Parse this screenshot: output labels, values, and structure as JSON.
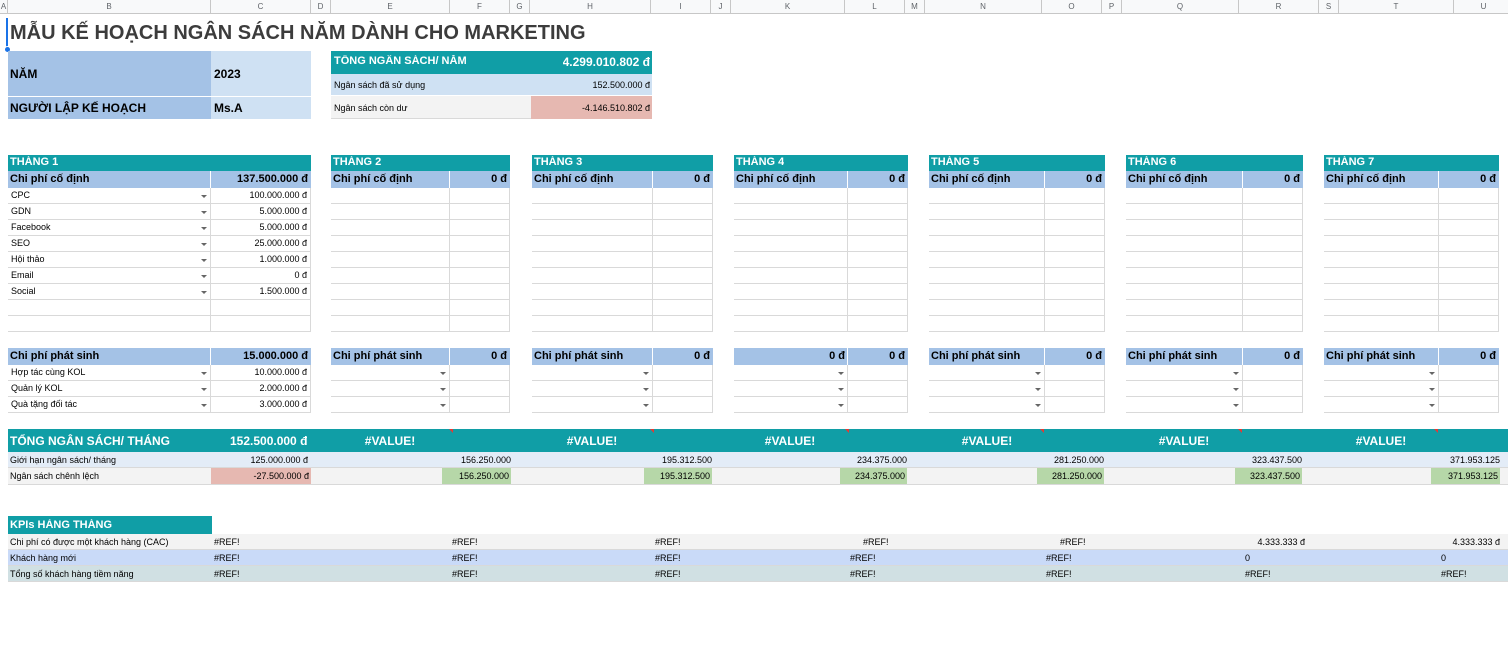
{
  "columns": [
    "A",
    "B",
    "C",
    "D",
    "E",
    "F",
    "G",
    "H",
    "I",
    "J",
    "K",
    "L",
    "M",
    "N",
    "O",
    "P",
    "Q",
    "R",
    "S",
    "T",
    "U"
  ],
  "title": "MẪU KẾ HOẠCH NGÂN SÁCH NĂM DÀNH CHO MARKETING",
  "info": {
    "year_label": "NĂM",
    "year_value": "2023",
    "planner_label": "NGƯỜI LẬP KẾ HOẠCH",
    "planner_value": "Ms.A"
  },
  "summary": {
    "total_label": "TỔNG NGÂN SÁCH/ NĂM",
    "total_value": "4.299.010.802 đ",
    "used_label": "Ngân sách đã sử dụng",
    "used_value": "152.500.000 đ",
    "remain_label": "Ngân sách còn dư",
    "remain_value": "-4.146.510.802 đ"
  },
  "month1": {
    "title": "THÁNG 1",
    "fixed_label": "Chi phí cố định",
    "fixed_total": "137.500.000 đ",
    "fixed_items": [
      {
        "name": "CPC",
        "value": "100.000.000 đ"
      },
      {
        "name": "GDN",
        "value": "5.000.000 đ"
      },
      {
        "name": "Facebook",
        "value": "5.000.000 đ"
      },
      {
        "name": "SEO",
        "value": "25.000.000 đ"
      },
      {
        "name": "Hội thảo",
        "value": "1.000.000 đ"
      },
      {
        "name": "Email",
        "value": "0 đ"
      },
      {
        "name": "Social",
        "value": "1.500.000 đ"
      }
    ],
    "var_label": "Chi phí phát sinh",
    "var_total": "15.000.000 đ",
    "var_items": [
      {
        "name": "Hợp tác cùng KOL",
        "value": "10.000.000 đ"
      },
      {
        "name": "Quản lý KOL",
        "value": "2.000.000 đ"
      },
      {
        "name": "Quà tặng đối tác",
        "value": "3.000.000 đ"
      }
    ]
  },
  "months": [
    {
      "title": "THÁNG 2",
      "fixed_label": "Chi phí cố định",
      "fixed_total": "0 đ",
      "var_label": "Chi phí phát sinh",
      "var_total": "0 đ"
    },
    {
      "title": "THÁNG 3",
      "fixed_label": "Chi phí cố định",
      "fixed_total": "0 đ",
      "var_label": "Chi phí phát sinh",
      "var_total": "0 đ"
    },
    {
      "title": "THÁNG 4",
      "fixed_label": "Chi phí cố định",
      "fixed_total": "0 đ",
      "var_label": "0 đ",
      "var_total": "0 đ"
    },
    {
      "title": "THÁNG 5",
      "fixed_label": "Chi phí cố định",
      "fixed_total": "0 đ",
      "var_label": "Chi phí phát sinh",
      "var_total": "0 đ"
    },
    {
      "title": "THÁNG 6",
      "fixed_label": "Chi phí cố định",
      "fixed_total": "0 đ",
      "var_label": "Chi phí phát sinh",
      "var_total": "0 đ"
    },
    {
      "title": "THÁNG 7",
      "fixed_label": "Chi phí cố định",
      "fixed_total": "0 đ",
      "var_label": "Chi phí phát sinh",
      "var_total": "0 đ"
    }
  ],
  "monthly_budget": {
    "label": "TỔNG NGÂN SÁCH/ THÁNG",
    "m1_total": "152.500.000 đ",
    "totals": [
      "#VALUE!",
      "#VALUE!",
      "#VALUE!",
      "#VALUE!",
      "#VALUE!",
      "#VALUE!"
    ],
    "limit_label": "Giới hạn ngân sách/ tháng",
    "m1_limit": "125.000.000 đ",
    "limits": [
      "156.250.000",
      "195.312.500",
      "234.375.000",
      "281.250.000",
      "323.437.500",
      "371.953.125"
    ],
    "diff_label": "Ngân sách chênh lệch",
    "m1_diff": "-27.500.000 đ",
    "diffs": [
      "156.250.000",
      "195.312.500",
      "234.375.000",
      "281.250.000",
      "323.437.500",
      "371.953.125"
    ]
  },
  "kpis": {
    "title": "KPIs HÀNG THÁNG",
    "rows": [
      {
        "label": "Chi phí có được một khách hàng (CAC)",
        "values": [
          "#REF!",
          "#REF!",
          "#REF!",
          "#REF!",
          "#REF!",
          "4.333.333 đ",
          "4.333.333 đ"
        ]
      },
      {
        "label": "Khách hàng mới",
        "values": [
          "#REF!",
          "#REF!",
          "#REF!",
          "#REF!",
          "#REF!",
          "0",
          "0"
        ]
      },
      {
        "label": "Tổng số khách hàng tiềm năng",
        "values": [
          "#REF!",
          "#REF!",
          "#REF!",
          "#REF!",
          "#REF!",
          "#REF!",
          "#REF!"
        ]
      }
    ]
  }
}
